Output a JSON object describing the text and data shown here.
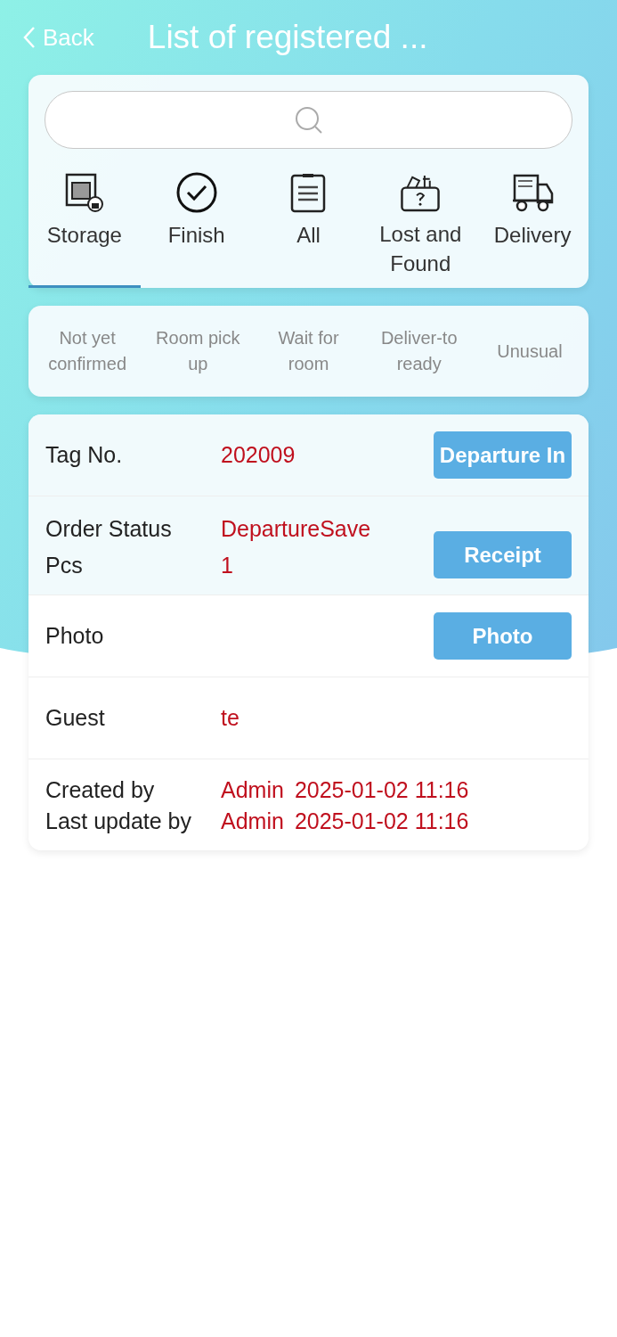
{
  "header": {
    "back": "Back",
    "title": "List of registered ..."
  },
  "tabs": [
    {
      "label": "Storage",
      "selected": true
    },
    {
      "label": "Finish",
      "selected": false
    },
    {
      "label": "All",
      "selected": false
    },
    {
      "label": "Lost and Found",
      "selected": false
    },
    {
      "label": "Delivery",
      "selected": false
    }
  ],
  "status_filters": [
    "Not yet confirmed",
    "Room pick up",
    "Wait for room",
    "Deliver-to ready",
    "Unusual"
  ],
  "details": [
    {
      "kind": "lines",
      "lines": [
        {
          "label": "Tag No.",
          "value": "202009"
        }
      ],
      "button": "Departure In"
    },
    {
      "kind": "lines",
      "lines": [
        {
          "label": "Order Status",
          "value": "DepartureSave"
        },
        {
          "label": "Pcs",
          "value": "1"
        }
      ],
      "button": "Receipt"
    },
    {
      "kind": "lines",
      "lines": [
        {
          "label": "Photo"
        }
      ],
      "button": "Photo"
    },
    {
      "kind": "lines",
      "lines": [
        {
          "label": "Guest",
          "value": "te"
        }
      ]
    },
    {
      "kind": "audit",
      "lines": [
        {
          "label": "Created by",
          "user": "Admin",
          "time": "2025-01-02 11:16"
        },
        {
          "label": "Last update by",
          "user": "Admin",
          "time": "2025-01-02 11:16"
        }
      ]
    }
  ]
}
